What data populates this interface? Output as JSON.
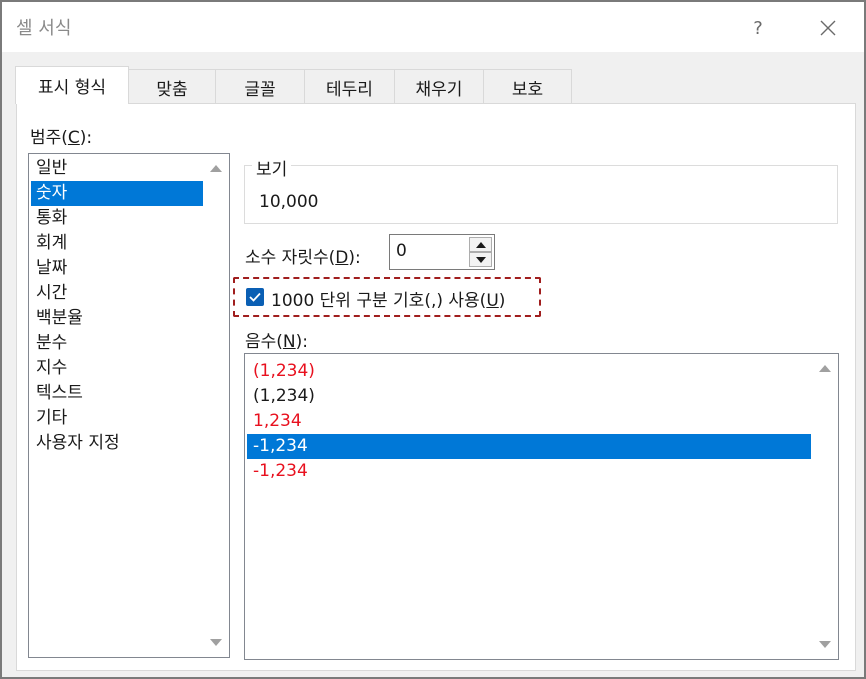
{
  "window": {
    "title": "셀 서식",
    "help_label": "?"
  },
  "tabs": [
    {
      "label": "표시 형식",
      "active": true
    },
    {
      "label": "맞춤",
      "active": false
    },
    {
      "label": "글꼴",
      "active": false
    },
    {
      "label": "테두리",
      "active": false
    },
    {
      "label": "채우기",
      "active": false
    },
    {
      "label": "보호",
      "active": false
    }
  ],
  "category": {
    "label_pre": "범주(",
    "label_key": "C",
    "label_post": "):",
    "items": [
      "일반",
      "숫자",
      "통화",
      "회계",
      "날짜",
      "시간",
      "백분율",
      "분수",
      "지수",
      "텍스트",
      "기타",
      "사용자 지정"
    ],
    "selected_index": 1
  },
  "sample": {
    "label": "보기",
    "value": "10,000"
  },
  "decimal": {
    "label_pre": "소수 자릿수(",
    "label_key": "D",
    "label_post": "):",
    "value": "0"
  },
  "separator": {
    "label_pre": "1000 단위 구분 기호(,) 사용(",
    "label_key": "U",
    "label_post": ")",
    "checked": true
  },
  "negative": {
    "label_pre": "음수(",
    "label_key": "N",
    "label_post": "):",
    "items": [
      {
        "text": "(1,234)",
        "color": "#e8101e"
      },
      {
        "text": "(1,234)",
        "color": "#1a1a1a"
      },
      {
        "text": "1,234",
        "color": "#e8101e"
      },
      {
        "text": "-1,234",
        "color": "#1a1a1a"
      },
      {
        "text": "-1,234",
        "color": "#e8101e"
      }
    ],
    "selected_index": 3
  },
  "colors": {
    "accent": "#0078d7",
    "highlight_border": "#a01e1e",
    "negative_red": "#e8101e"
  }
}
